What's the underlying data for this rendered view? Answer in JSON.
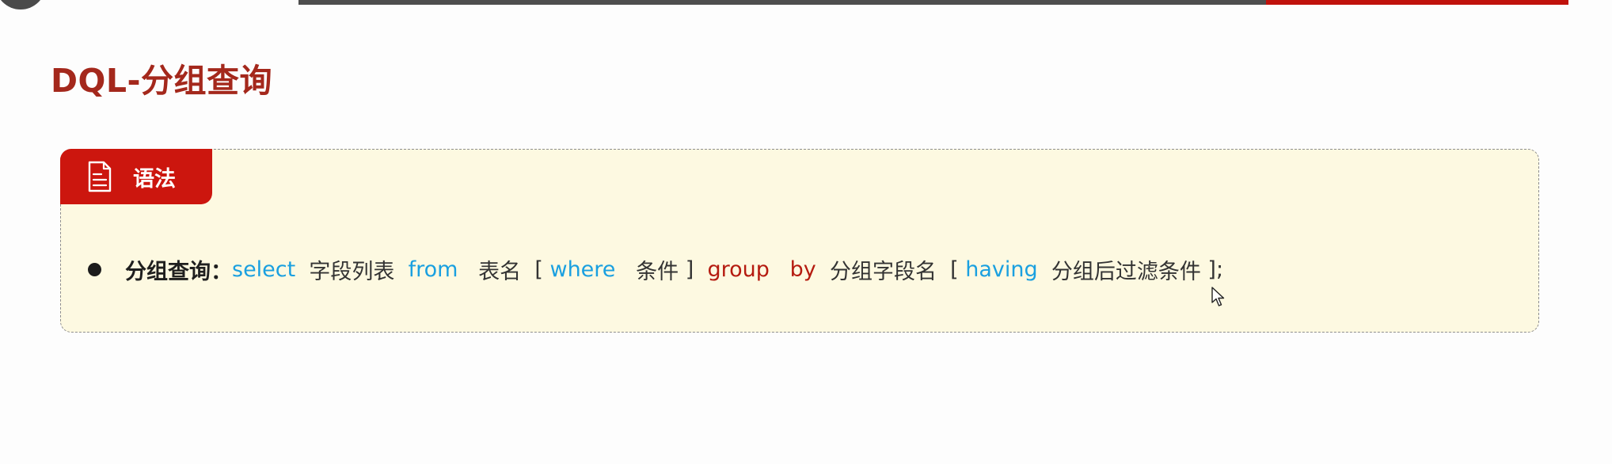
{
  "header": {
    "title": "DQL-分组查询"
  },
  "syntax_panel": {
    "tab_label": "语法",
    "tab_icon": "document-icon",
    "line": {
      "label": "分组查询：",
      "tokens": [
        {
          "text": "select",
          "style": "keyword-blue"
        },
        {
          "text": "字段列表",
          "style": "plain"
        },
        {
          "text": "from",
          "style": "keyword-blue"
        },
        {
          "text": "表名",
          "style": "plain"
        },
        {
          "text": "[",
          "style": "plain"
        },
        {
          "text": "where",
          "style": "keyword-blue"
        },
        {
          "text": "条件",
          "style": "plain"
        },
        {
          "text": "]",
          "style": "plain"
        },
        {
          "text": "group",
          "style": "keyword-red"
        },
        {
          "text": "by",
          "style": "keyword-red"
        },
        {
          "text": "分组字段名",
          "style": "plain"
        },
        {
          "text": "[",
          "style": "plain"
        },
        {
          "text": "having",
          "style": "keyword-blue"
        },
        {
          "text": "分组后过滤条件",
          "style": "plain"
        },
        {
          "text": "];",
          "style": "plain"
        }
      ]
    }
  },
  "colors": {
    "title": "#a4281c",
    "tab_background": "#cc160e",
    "panel_background": "#fdf9e1",
    "keyword_blue": "#1aa0e0",
    "keyword_red": "#b51b10",
    "accent_line": "#c0120c"
  }
}
